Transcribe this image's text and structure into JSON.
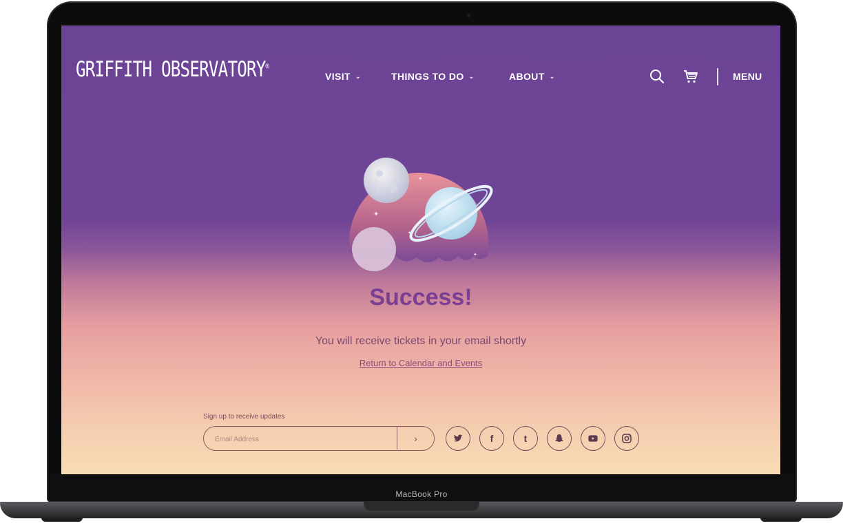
{
  "device": {
    "model": "MacBook Pro"
  },
  "header": {
    "logo": "GRIFFITH OBSERVATORY",
    "logo_mark": "®",
    "nav": [
      {
        "label": "VISIT",
        "chevron": "chevron-down-icon"
      },
      {
        "label": "THINGS TO DO",
        "chevron": "chevron-down-icon"
      },
      {
        "label": "ABOUT",
        "chevron": "chevron-down-icon"
      }
    ],
    "icons": [
      "search-icon",
      "cart-icon"
    ],
    "menu_label": "MENU"
  },
  "main": {
    "title": "Success!",
    "message": "You will receive tickets in your email shortly",
    "link": "Return to Calendar and Events",
    "illustration": "planets-illustration"
  },
  "footer": {
    "signup_label": "Sign up to receive updates",
    "email_placeholder": "Email Address",
    "submit_icon": "chevron-right-icon",
    "social": [
      {
        "name": "twitter-icon",
        "glyph": "🐦"
      },
      {
        "name": "facebook-icon",
        "glyph": "f"
      },
      {
        "name": "tumblr-icon",
        "glyph": "t"
      },
      {
        "name": "snapchat-icon",
        "glyph": "👻"
      },
      {
        "name": "youtube-icon",
        "glyph": "▶"
      },
      {
        "name": "instagram-icon",
        "glyph": "◎"
      }
    ]
  },
  "colors": {
    "header_bg": "#6f4496",
    "title": "#7a3f93",
    "text": "#7a4a6f"
  }
}
